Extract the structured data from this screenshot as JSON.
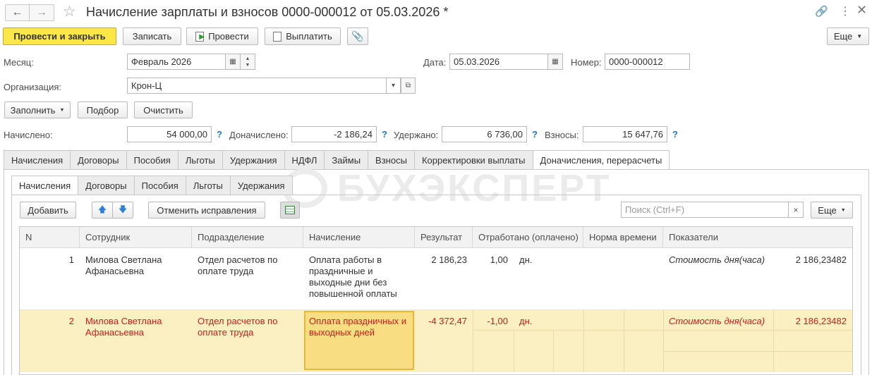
{
  "window": {
    "title": "Начисление зарплаты и взносов 0000-000012 от 05.03.2026 *"
  },
  "toolbar": {
    "post_close": "Провести и закрыть",
    "save": "Записать",
    "post": "Провести",
    "pay": "Выплатить",
    "more": "Еще"
  },
  "form": {
    "month_label": "Месяц:",
    "month_value": "Февраль 2026",
    "date_label": "Дата:",
    "date_value": "05.03.2026",
    "number_label": "Номер:",
    "number_value": "0000-000012",
    "org_label": "Организация:",
    "org_value": "Крон-Ц"
  },
  "actions": {
    "fill": "Заполнить",
    "pick": "Подбор",
    "clear": "Очистить"
  },
  "totals": {
    "accrued_label": "Начислено:",
    "accrued_value": "54 000,00",
    "extra_label": "Доначислено:",
    "extra_value": "-2 186,24",
    "withheld_label": "Удержано:",
    "withheld_value": "6 736,00",
    "contrib_label": "Взносы:",
    "contrib_value": "15 647,76",
    "help": "?"
  },
  "tabs": [
    "Начисления",
    "Договоры",
    "Пособия",
    "Льготы",
    "Удержания",
    "НДФЛ",
    "Займы",
    "Взносы",
    "Корректировки выплаты",
    "Доначисления, перерасчеты"
  ],
  "subtabs": [
    "Начисления",
    "Договоры",
    "Пособия",
    "Льготы",
    "Удержания"
  ],
  "watermark": "БУХЭКСПЕРТ",
  "table_toolbar": {
    "add": "Добавить",
    "cancel_fix": "Отменить исправления",
    "search_placeholder": "Поиск (Ctrl+F)",
    "more": "Еще"
  },
  "table": {
    "columns": [
      "N",
      "Сотрудник",
      "Подразделение",
      "Начисление",
      "Результат",
      "Отработано (оплачено)",
      "Норма времени",
      "Показатели"
    ],
    "rows": [
      {
        "n": "1",
        "employee": "Милова Светлана Афанасьевна",
        "dept": "Отдел расчетов по оплате труда",
        "accrual": "Оплата работы в праздничные и выходные дни без повышенной оплаты",
        "result": "2 186,23",
        "worked": "1,00",
        "unit": "дн.",
        "indicator": "Стоимость дня(часа)",
        "indicator_value": "2 186,23482"
      },
      {
        "n": "2",
        "employee": "Милова Светлана Афанасьевна",
        "dept": "Отдел расчетов по оплате труда",
        "accrual": "Оплата праздничных и выходных дней",
        "result": "-4 372,47",
        "worked": "-1,00",
        "unit": "дн.",
        "indicator": "Стоимость дня(часа)",
        "indicator_value": "2 186,23482"
      }
    ]
  }
}
